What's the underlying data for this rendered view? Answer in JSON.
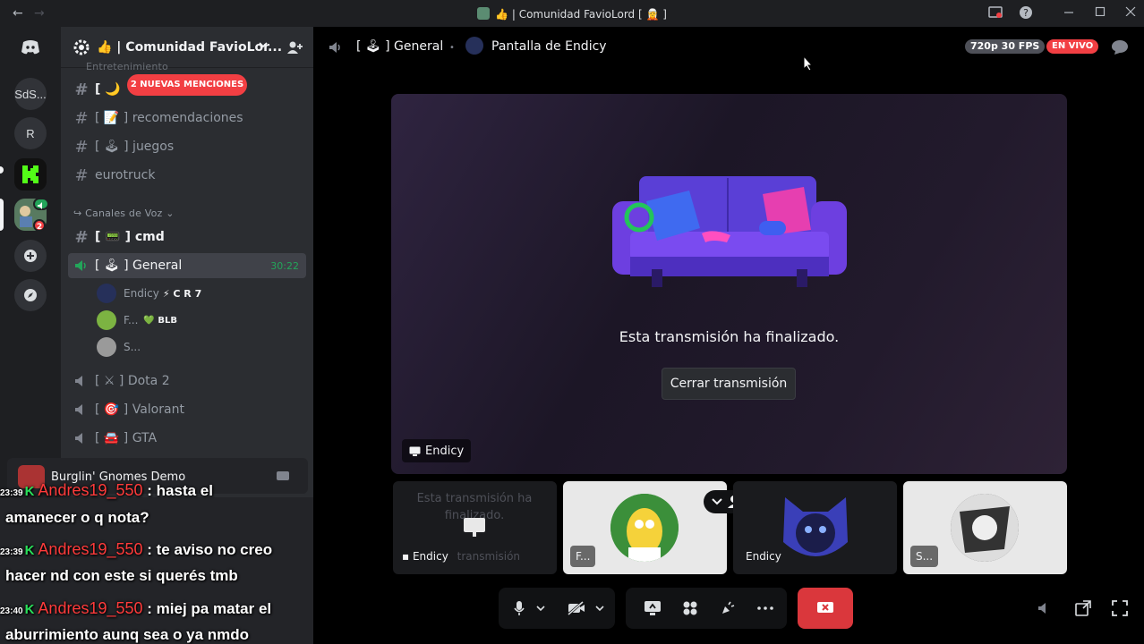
{
  "window": {
    "title": "👍 | Comunidad FavioLord [ 🧝 ]",
    "back_glyph": "←",
    "forward_glyph": "→"
  },
  "rail": {
    "servers": [
      {
        "label": "SdS..."
      },
      {
        "label": "R"
      }
    ],
    "badge_count": "2"
  },
  "server": {
    "name": "👍 | Comunidad FavioLor..."
  },
  "sidebar": {
    "category_top": "Entretenimiento",
    "mentions_badge": "2 NUEVAS MENCIONES",
    "text_channels": [
      {
        "label": "[ 🌙"
      },
      {
        "label": "[ 📝 ] recomendaciones"
      },
      {
        "label": "[ 🕹 ] juegos"
      },
      {
        "label": "eurotruck"
      }
    ],
    "voice_category": "Canales de Voz",
    "voice_channels": [
      {
        "label": "[ 📟 ] cmd"
      },
      {
        "label": "[ 🕹 ] General",
        "timer": "30:22"
      },
      {
        "label": "[ ⚔ ] Dota 2"
      },
      {
        "label": "[ 🎯 ] Valorant"
      },
      {
        "label": "[ 🚘 ] GTA"
      }
    ],
    "voice_users": [
      {
        "name": "Endicy",
        "tag": "⚡ C R 7"
      },
      {
        "name": "F...",
        "tag": "💚 BLB"
      },
      {
        "name": "S..."
      }
    ]
  },
  "activity": {
    "game_name": "Burglin' Gnomes Demo"
  },
  "chat": [
    {
      "time": "23:39",
      "nick": "Andres19_550",
      "line1": ": hasta el",
      "line2": "amanecer o q nota?"
    },
    {
      "time": "23:39",
      "nick": "Andres19_550",
      "line1": ": te aviso no creo",
      "line2": "hacer nd con este si querés tmb"
    },
    {
      "time": "23:40",
      "nick": "Andres19_550",
      "line1": ": miej pa matar el",
      "line2": "aburrimiento aunq sea o ya nmdo"
    }
  ],
  "header": {
    "channel": "[ 🕹 ] General",
    "separator": "•",
    "stream_title": "Pantalla de Endicy",
    "quality": "720p 30 FPS",
    "live": "EN VIVO"
  },
  "stage": {
    "ended_text": "Esta transmisión ha finalizado.",
    "close_label": "Cerrar transmisión",
    "streamer": "Endicy"
  },
  "tiles": [
    {
      "text": "Esta transmisión ha finalizado.",
      "label": "Endicy",
      "sub": "transmisión"
    },
    {
      "label": "F..."
    },
    {
      "label": "Endicy"
    },
    {
      "label": "S..."
    }
  ],
  "colors": {
    "accent_red": "#f23f43",
    "chat_nick": "#ff3b3b",
    "chat_k": "#29e05a",
    "voice_green": "#23a55a"
  }
}
